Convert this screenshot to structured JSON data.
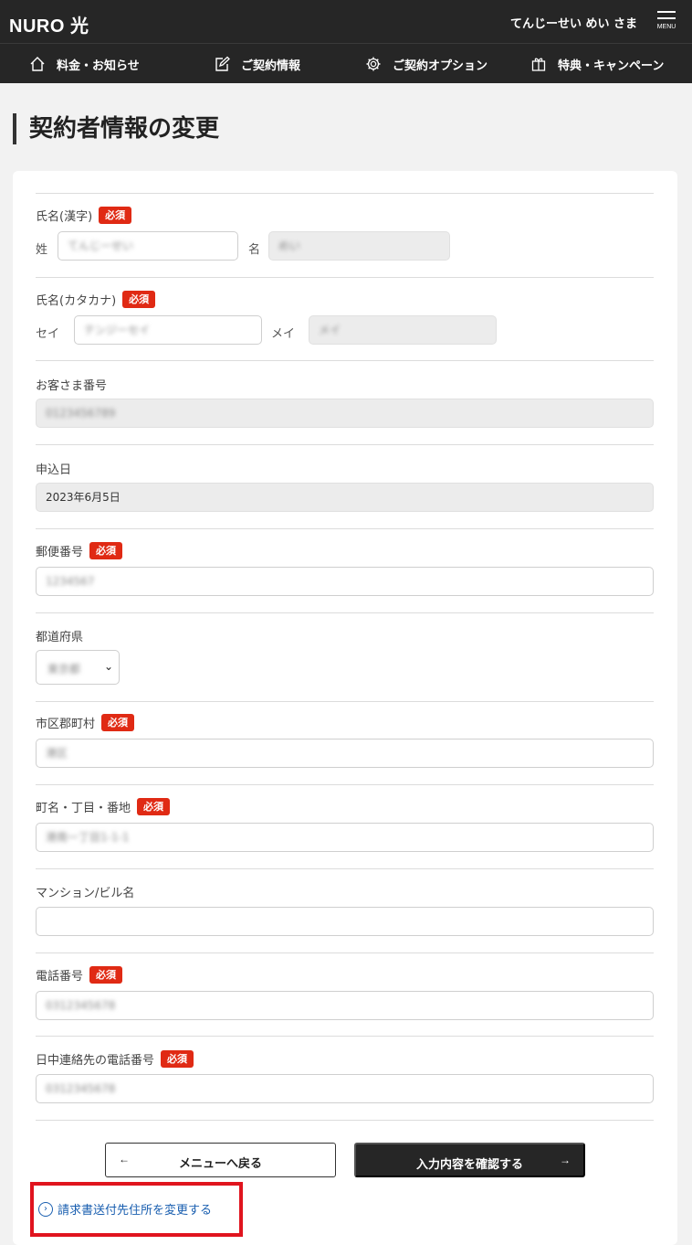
{
  "header": {
    "logo": "NURO 光",
    "username": "てんじーせい めい さま",
    "menu_label": "MENU"
  },
  "nav": {
    "items": [
      {
        "label": "料金・お知らせ",
        "icon": "home-icon"
      },
      {
        "label": "ご契約情報",
        "icon": "edit-icon"
      },
      {
        "label": "ご契約オプション",
        "icon": "gear-icon"
      },
      {
        "label": "特典・キャンペーン",
        "icon": "gift-icon"
      }
    ]
  },
  "page": {
    "title": "契約者情報の変更"
  },
  "required_badge": "必須",
  "form": {
    "name_kanji": {
      "label": "氏名(漢字)",
      "sei_label": "姓",
      "mei_label": "名",
      "sei_value": "てんじーせい",
      "mei_value": "めい"
    },
    "name_kana": {
      "label": "氏名(カタカナ)",
      "sei_label": "セイ",
      "mei_label": "メイ",
      "sei_value": "テンジーセイ",
      "mei_value": "メイ"
    },
    "customer_number": {
      "label": "お客さま番号",
      "value": "0123456789"
    },
    "application_date": {
      "label": "申込日",
      "value": "2023年6月5日"
    },
    "postal_code": {
      "label": "郵便番号",
      "value": "1234567"
    },
    "prefecture": {
      "label": "都道府県",
      "value": "東京都"
    },
    "city": {
      "label": "市区郡町村",
      "value": "港区"
    },
    "address": {
      "label": "町名・丁目・番地",
      "value": "港南一丁目1-1-1"
    },
    "building": {
      "label": "マンション/ビル名",
      "value": ""
    },
    "phone": {
      "label": "電話番号",
      "value": "0312345678"
    },
    "daytime_phone": {
      "label": "日中連絡先の電話番号",
      "value": "0312345678"
    }
  },
  "actions": {
    "back_label": "メニューへ戻る",
    "back_arrow": "←",
    "confirm_label": "入力内容を確認する",
    "confirm_arrow": "→",
    "billing_link": "請求書送付先住所を変更する"
  },
  "colors": {
    "header_bg": "#262626",
    "required_badge": "#e02a14",
    "highlight_border": "#e0141e",
    "link": "#1a5fb0"
  }
}
